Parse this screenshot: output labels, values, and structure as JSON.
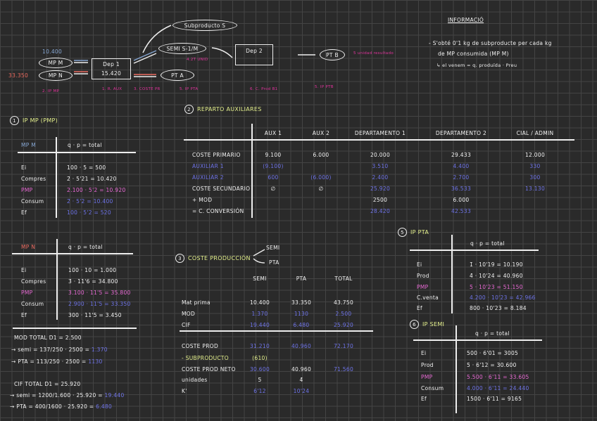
{
  "colors": {
    "background": "#2a2a2a",
    "magenta": "#e2339d",
    "blue": "#6e73e8",
    "light_blue": "#86a6d2",
    "salmon": "#ea6a5f",
    "yellow": "#e4f08c",
    "pmp_pink": "#ea6ad6"
  },
  "diagram": {
    "mp_m_value": "10.400",
    "mp_m": "MP M",
    "mp_n": "MP N",
    "mp_n_value": "33.350",
    "dep1": "Dep 1",
    "dep1_value": "15.420",
    "subproducto": "Subproducto S",
    "semi": "SEMI S-1/M",
    "semi_units": "4.2T UNID",
    "pta": "PT A",
    "dep2": "Dep 2",
    "ptb": "PT B",
    "ptb_note": "5 unidad resultado",
    "step_labels": [
      "2. IP MP",
      "1. R. AUX",
      "3. COSTE PR",
      "5. IP PTA",
      "6. C. Prod B1",
      "5. IP PTB"
    ]
  },
  "info": {
    "title": "INFORMACIÓ",
    "lines": [
      "- S'obté 0'1 kg de subproducte per cada kg",
      "de MP consumida (MP M)",
      "↳ el venem = q. produïda · Preu"
    ]
  },
  "section1": {
    "number": "1",
    "title": "IP MP (PMP)",
    "mpm": {
      "header_label": "MP M",
      "header": "q · p = total",
      "rows": [
        {
          "label": "Ei",
          "value": "100 · 5 = 500"
        },
        {
          "label": "Compres",
          "value": "2̄ · 5'21 = 10.420"
        },
        {
          "label": "PMP",
          "value": "2.100 · 5'2 = 10.920"
        },
        {
          "label": "Consum",
          "value": "2̄ · 5'2 = 10.400"
        },
        {
          "label": "Ef",
          "value": "100 · 5'2 = 520"
        }
      ]
    },
    "mpn": {
      "header_label": "MP N",
      "header": "q · p = total",
      "rows": [
        {
          "label": "Ei",
          "value": "100 · 10 = 1.000"
        },
        {
          "label": "Compres",
          "value": "3̄ · 11'6 = 34.800"
        },
        {
          "label": "PMP",
          "value": "3.100 · 11'5 = 35.800"
        },
        {
          "label": "Consum",
          "value": "2.900 · 11'5 = 33.350"
        },
        {
          "label": "Ef",
          "value": "300 · 11'5 = 3.450"
        }
      ]
    },
    "mod": {
      "total": "MOD TOTAL D1 = 2.500",
      "semi": "→ semi = 137/250 · 2500 = ",
      "semi_result": "1.370",
      "pta": "→ PTA = 113/250 · 2500 = ",
      "pta_result": "1130"
    },
    "cif": {
      "total": "CIF TOTAL D1 = 25.920",
      "semi": "→ semi = 1200/1.600 · 25.920 = ",
      "semi_result": "19.440",
      "pta": "→ PTA = 400/1600 · 25.920 = ",
      "pta_result": "6.480"
    }
  },
  "section2": {
    "number": "2",
    "title": "REPARTO AUXILIARES",
    "columns": [
      "AUX 1",
      "AUX 2",
      "DEPARTAMENTO 1",
      "DEPARTAMENTO 2",
      "CIAL / ADMIN"
    ],
    "rows": [
      {
        "label": "COSTE PRIMARIO",
        "values": [
          "9.100",
          "6.000",
          "20.000",
          "29.433",
          "12.000"
        ]
      },
      {
        "label": "AUXILIAR 1",
        "values": [
          "(9.100)",
          "",
          "3.510",
          "4.400",
          "330"
        ]
      },
      {
        "label": "AUXILIAR 2",
        "values": [
          "600",
          "(6.000)",
          "2.400",
          "2.700",
          "300"
        ]
      },
      {
        "label": "COSTE SECUNDARIO",
        "values": [
          "∅",
          "∅",
          "25.920",
          "36.533",
          "13.130"
        ]
      },
      {
        "label": "+ MOD",
        "values": [
          "",
          "",
          "2500",
          "6.000",
          ""
        ]
      },
      {
        "label": "= C. CONVERSIÓN",
        "values": [
          "",
          "",
          "28.420",
          "42.533",
          ""
        ]
      }
    ]
  },
  "section3": {
    "number": "3",
    "title": "COSTE PRODUCCIÓN",
    "branches": [
      "SEMI",
      "PTA"
    ],
    "columns": [
      "SEMI",
      "PTA",
      "TOTAL"
    ],
    "rows": [
      {
        "label": "Mat prima",
        "values": [
          "10.400",
          "33.350",
          "43.750"
        ]
      },
      {
        "label": "MOD",
        "values": [
          "1.370",
          "1130",
          "2.500"
        ]
      },
      {
        "label": "CIF",
        "values": [
          "19.440",
          "6.480",
          "25.920"
        ]
      },
      {
        "label": "COSTE PROD",
        "values": [
          "31.210",
          "40.960",
          "72.170"
        ]
      },
      {
        "label": "- SUBPRODUCTO",
        "values": [
          "(610)",
          "",
          ""
        ]
      },
      {
        "label": "COSTE PROD NETO",
        "values": [
          "30.600",
          "40.960",
          "71.560"
        ]
      },
      {
        "label": "unidades",
        "values": [
          "5̄",
          "4̄",
          ""
        ]
      },
      {
        "label": "K'",
        "values": [
          "6'12",
          "10'24",
          ""
        ]
      }
    ]
  },
  "section5": {
    "number": "5",
    "title": "IP PTA",
    "header": "q · p = total",
    "rows": [
      {
        "label": "Ei",
        "value": "1̄ · 10'19 = 10.190"
      },
      {
        "label": "Prod",
        "value": "4̄ · 10'24 = 40.960"
      },
      {
        "label": "PMP",
        "value": "5̄ · 10'23 = 51.150"
      },
      {
        "label": "C.venta",
        "value": "4.200 · 10'23 = 42.966"
      },
      {
        "label": "Ef",
        "value": "800 · 10'23 = 8.184"
      }
    ]
  },
  "section6": {
    "number": "6",
    "title": "IP SEMI",
    "header": "q · p = total",
    "rows": [
      {
        "label": "Ei",
        "value": "500 · 6'01 = 3005"
      },
      {
        "label": "Prod",
        "value": "5̄ · 6'12 = 30.600"
      },
      {
        "label": "PMP",
        "value": "5.500 · 6'11 = 33.605"
      },
      {
        "label": "Consum",
        "value": "4.000 · 6'11 = 24.440"
      },
      {
        "label": "Ef",
        "value": "1500 · 6'11 = 9165"
      }
    ]
  }
}
